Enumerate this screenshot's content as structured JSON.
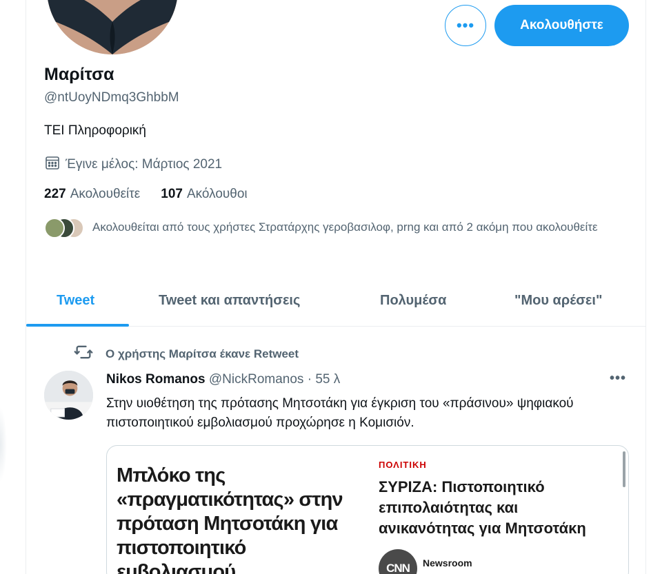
{
  "profile": {
    "name": "Μαρίτσα",
    "handle": "@ntUoyNDmq3GhbbM",
    "bio": "ΤΕΙ Πληροφορική",
    "joined": "Έγινε μέλος: Μάρτιος 2021",
    "following_count": "227",
    "following_label": "Ακολουθείτε",
    "followers_count": "107",
    "followers_label": "Ακόλουθοι",
    "followed_by": "Ακολουθείται από τους χρήστες Στρατάρχης γεροβασιλοφ, prng και από 2 ακόμη που ακολουθείτε"
  },
  "actions": {
    "more_label": "•••",
    "follow_label": "Ακολουθήστε"
  },
  "tabs": [
    {
      "label": "Tweet",
      "active": true
    },
    {
      "label": "Tweet και απαντήσεις",
      "active": false
    },
    {
      "label": "Πολυμέσα",
      "active": false
    },
    {
      "label": "\"Μου αρέσει\"",
      "active": false
    }
  ],
  "tweet": {
    "retweet_note": "Ο χρήστης Μαρίτσα έκανε Retweet",
    "author": "Nikos Romanos",
    "handle": "@NickRomanos",
    "separator": "·",
    "time": "55 λ",
    "more_label": "•••",
    "text": "Στην υιοθέτηση της πρότασης Μητσοτάκη για έγκριση του «πράσινου» ψηφιακού πιστοποιητικού εμβολιασμού προχώρησε η Κομισιόν.",
    "card": {
      "left_headline": "Μπλόκο της «πραγματικότητας» στην πρόταση Μητσοτάκη για πιστοποιητικό εμβολιασμού",
      "section": "ΠΟΛΙΤΙΚΗ",
      "title": "ΣΥΡΙΖΑ: Πιστοποιητικό επιπολαιότητας και ανικανότητας για Μητσοτάκη",
      "logo": "CNN",
      "source": "Newsroom"
    }
  },
  "colors": {
    "accent": "#1d9bf0",
    "text": "#0f1419",
    "secondary": "#536471",
    "border": "#ebeef0"
  }
}
